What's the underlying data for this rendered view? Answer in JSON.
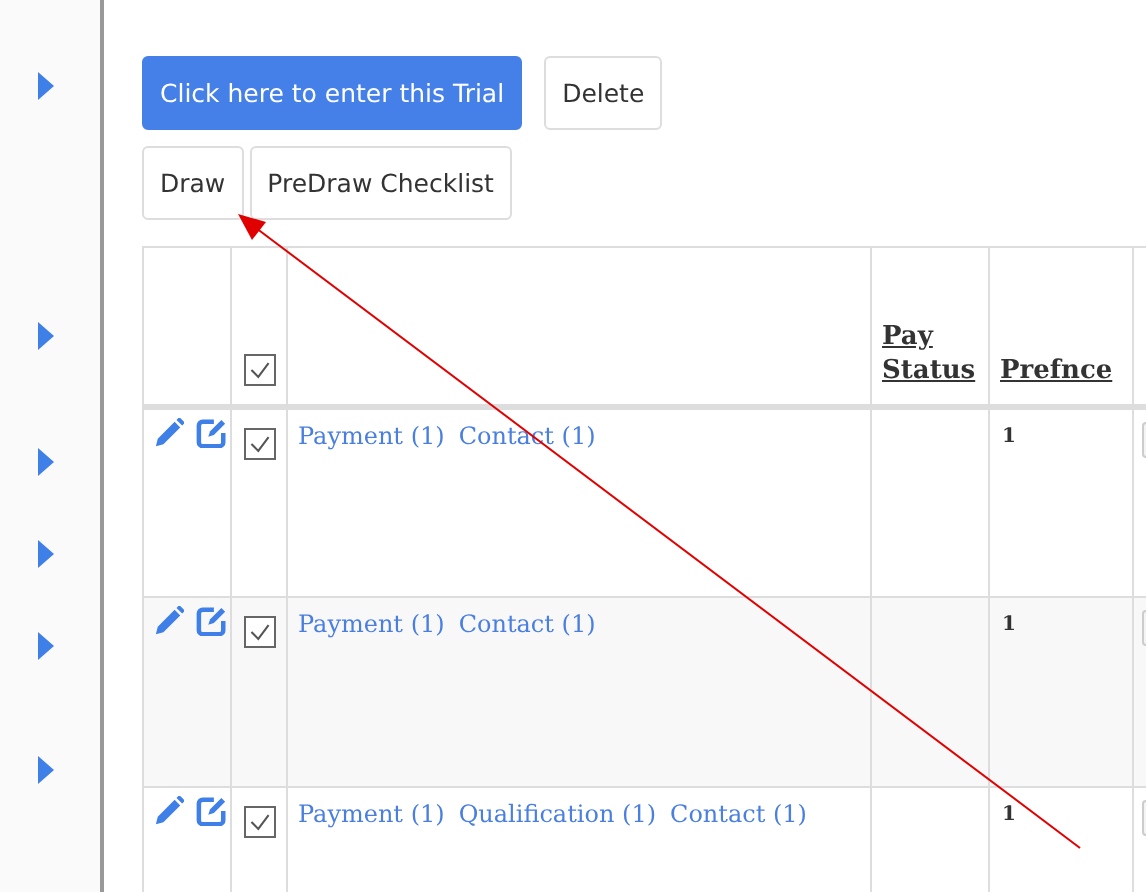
{
  "sidebar": {
    "items": [
      {
        "kind": "expander",
        "expanded": false
      },
      {
        "kind": "expander",
        "expanded": false
      },
      {
        "kind": "expander",
        "expanded": false
      },
      {
        "kind": "expander",
        "expanded": false
      },
      {
        "kind": "expander",
        "expanded": false
      },
      {
        "kind": "expander",
        "expanded": false
      }
    ]
  },
  "button_rows": [
    [
      {
        "label": "Click here to enter this Trial",
        "kind": "primary"
      },
      {
        "label": "Delete",
        "kind": "default"
      }
    ],
    [
      {
        "label": "Draw",
        "kind": "default"
      },
      {
        "label": "PreDraw Checklist",
        "kind": "default"
      }
    ]
  ],
  "table": {
    "header": {
      "select_all_checked": true,
      "columns": [
        {
          "label": "Pay Status"
        },
        {
          "label": "Prefnce"
        }
      ]
    },
    "rows": [
      {
        "checked": true,
        "links": [
          "Payment (1)",
          "Contact (1)"
        ],
        "pay_status": "",
        "prefnce": "1"
      },
      {
        "checked": true,
        "links": [
          "Payment (1)",
          "Contact (1)"
        ],
        "pay_status": "",
        "prefnce": "1"
      },
      {
        "checked": true,
        "links": [
          "Payment (1)",
          "Qualification (1)",
          "Contact (1)"
        ],
        "pay_status": "",
        "prefnce": "1"
      }
    ]
  },
  "annotation": {
    "kind": "arrow"
  }
}
